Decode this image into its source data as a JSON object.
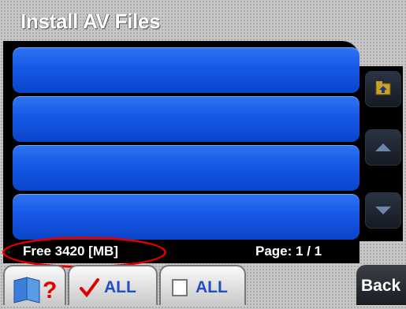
{
  "header": {
    "title": "Install AV Files"
  },
  "list": {
    "rows": [
      "",
      "",
      "",
      ""
    ]
  },
  "side_buttons": [
    {
      "icon": "folder-up-icon"
    },
    {
      "icon": "arrow-up-icon"
    },
    {
      "icon": "arrow-down-icon"
    }
  ],
  "status": {
    "free_space": "Free 3420 [MB]",
    "page": "Page: 1 / 1"
  },
  "bottom_tabs": {
    "help_icon": "book-help-icon",
    "select_all_label": "ALL",
    "deselect_all_label": "ALL",
    "back_label": "Back"
  },
  "colors": {
    "row_blue": "#1658e6",
    "annotation_red": "#e00000",
    "checkmark_red": "#e00000",
    "label_blue": "#1f4fc3"
  }
}
